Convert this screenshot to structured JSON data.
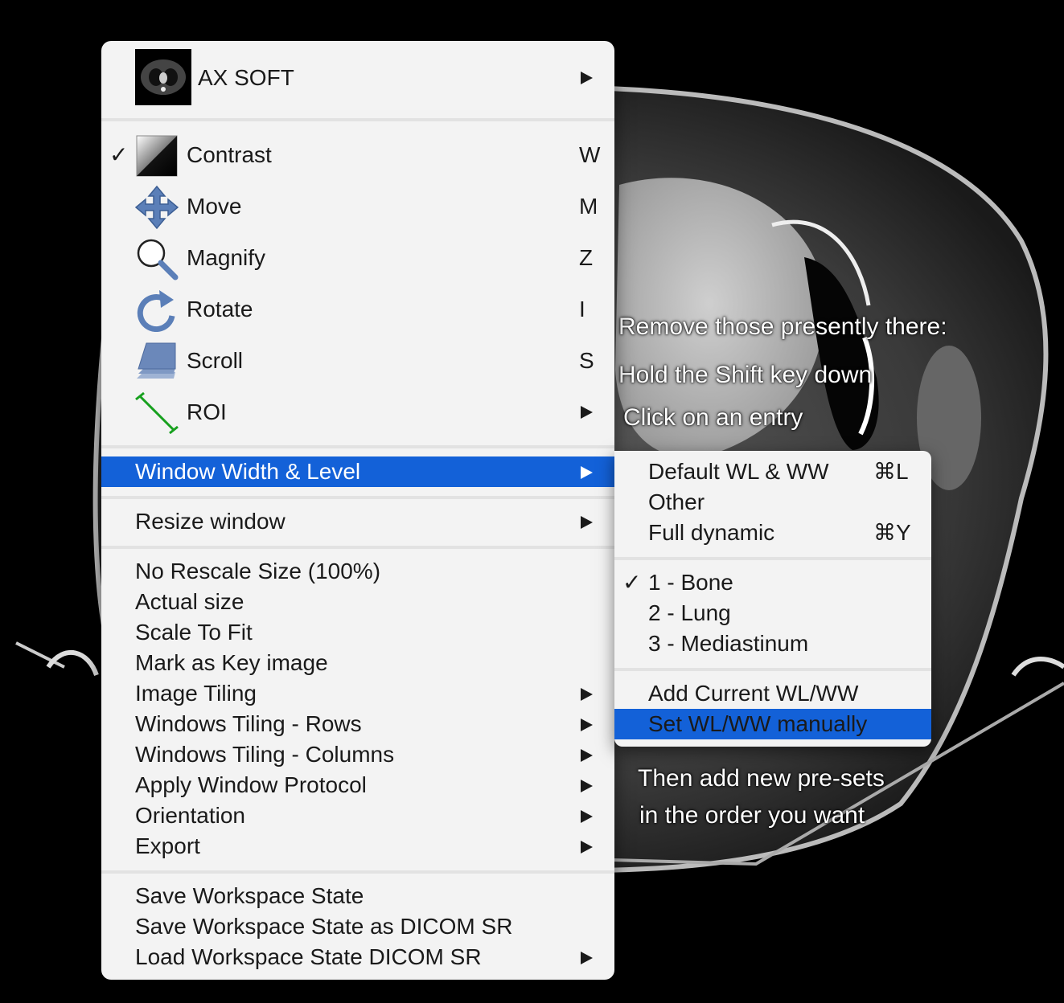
{
  "background": {
    "annotations_top": [
      "Remove those presently there:",
      "Hold the Shift key down",
      "Click on an entry"
    ],
    "annotations_bottom": [
      "Then add new pre-sets",
      "in the order you want"
    ]
  },
  "menu": {
    "series": {
      "label": "AX SOFT",
      "icon": "ct-thumbnail-icon"
    },
    "tools": [
      {
        "label": "Contrast",
        "shortcut": "W",
        "checked": true,
        "icon": "contrast-icon"
      },
      {
        "label": "Move",
        "shortcut": "M",
        "icon": "move-icon"
      },
      {
        "label": "Magnify",
        "shortcut": "Z",
        "icon": "magnify-icon"
      },
      {
        "label": "Rotate",
        "shortcut": "I",
        "icon": "rotate-icon"
      },
      {
        "label": "Scroll",
        "shortcut": "S",
        "icon": "scroll-icon"
      },
      {
        "label": "ROI",
        "submenu": true,
        "icon": "roi-icon"
      }
    ],
    "window_level": "Window Width & Level",
    "resize": "Resize window",
    "view_items": [
      {
        "label": "No Rescale Size (100%)"
      },
      {
        "label": "Actual size"
      },
      {
        "label": "Scale To Fit"
      },
      {
        "label": "Mark as Key image"
      },
      {
        "label": "Image Tiling",
        "submenu": true
      },
      {
        "label": "Windows Tiling - Rows",
        "submenu": true
      },
      {
        "label": "Windows Tiling - Columns",
        "submenu": true
      },
      {
        "label": "Apply Window Protocol",
        "submenu": true
      },
      {
        "label": "Orientation",
        "submenu": true
      },
      {
        "label": "Export",
        "submenu": true
      }
    ],
    "workspace_items": [
      {
        "label": "Save Workspace State"
      },
      {
        "label": "Save Workspace State as DICOM SR"
      },
      {
        "label": "Load Workspace State DICOM SR",
        "submenu": true
      }
    ]
  },
  "submenu": {
    "defaults": [
      {
        "label": "Default WL & WW",
        "shortcut": "⌘L"
      },
      {
        "label": "Other",
        "shortcut": ""
      },
      {
        "label": "Full dynamic",
        "shortcut": "⌘Y"
      }
    ],
    "presets": [
      {
        "label": "1 - Bone",
        "checked": true
      },
      {
        "label": "2 - Lung"
      },
      {
        "label": "3 - Mediastinum"
      }
    ],
    "actions": [
      {
        "label": "Add Current WL/WW"
      },
      {
        "label": "Set WL/WW manually"
      }
    ]
  },
  "colors": {
    "highlight": "#1361d8",
    "menu_bg": "#f3f3f3",
    "roi_green": "#17a01e",
    "tool_blue": "#5b7fb8"
  }
}
